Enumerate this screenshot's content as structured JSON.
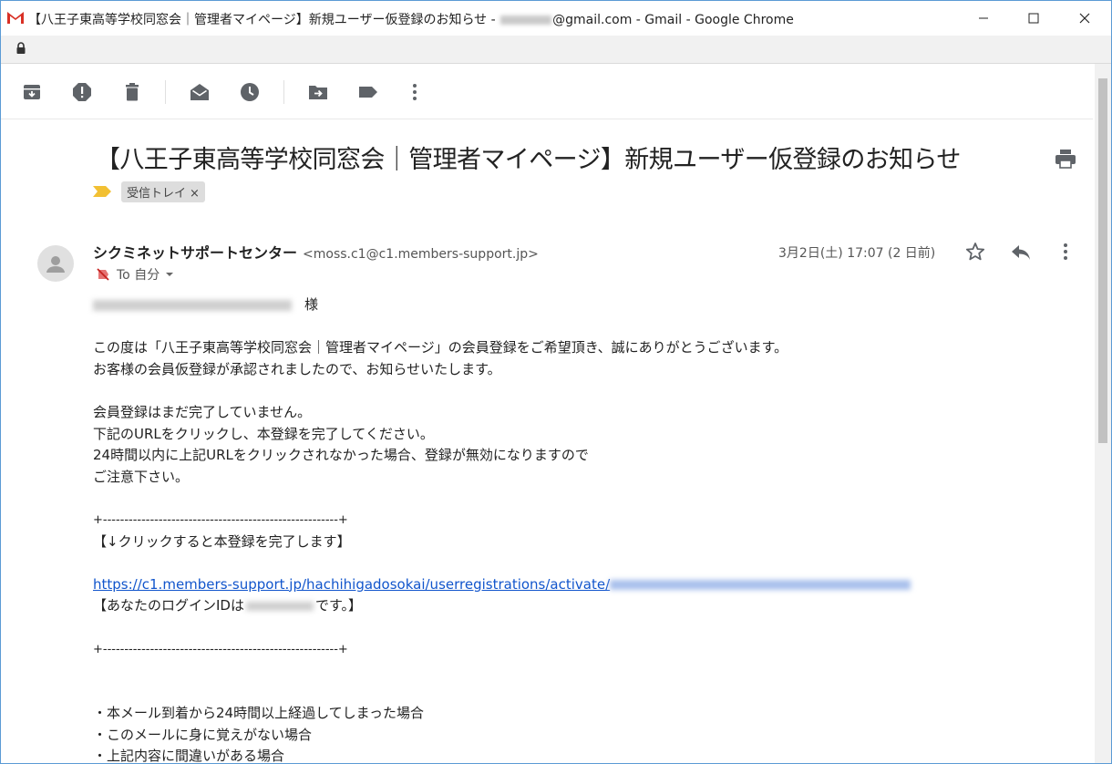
{
  "window": {
    "title_prefix": "【八王子東高等学校同窓会｜管理者マイページ】新規ユーザー仮登録のお知らせ - ",
    "title_suffix": "@gmail.com - Gmail - Google Chrome",
    "title_redacted": "takeno23"
  },
  "toolbar": {
    "icons": [
      "archive-icon",
      "report-spam-icon",
      "delete-icon",
      "mark-unread-icon",
      "snooze-icon",
      "move-to-icon",
      "labels-icon",
      "more-icon"
    ]
  },
  "message": {
    "subject": "【八王子東高等学校同窓会｜管理者マイページ】新規ユーザー仮登録のお知らせ",
    "label": "受信トレイ",
    "label_close": "×",
    "sender_name": "シクミネットサポートセンター",
    "sender_email": "<moss.c1@c1.members-support.jp>",
    "to": "To 自分",
    "date": "3月2日(土) 17:07 (2 日前)"
  },
  "body": {
    "salutation_redacted": "テスト テスト (テスト テスト)",
    "salutation": "様",
    "p1": "この度は「八王子東高等学校同窓会｜管理者マイページ」の会員登録をご希望頂き、誠にありがとうございます。",
    "p2": "お客様の会員仮登録が承認されましたので、お知らせいたします。",
    "p3": "会員登録はまだ完了していません。",
    "p4": "下記のURLをクリックし、本登録を完了してください。",
    "p5": "24時間以内に上記URLをクリックされなかった場合、登録が無効になりますので",
    "p6": "ご注意下さい。",
    "divider": "+-------------------------------------------------------+",
    "click_note": "【↓クリックすると本登録を完了します】",
    "link": "https://c1.members-support.jp/hachihigadosokai/userregistrations/activate/",
    "link_redacted": "14276ee034539e797ece7a7624%22c2f9f29c",
    "login_prefix": "【あなたのログインIDは",
    "login_redacted": "00400039",
    "login_suffix": "です。】",
    "bullet1": "・本メール到着から24時間以上経過してしまった場合",
    "bullet2": "・このメールに身に覚えがない場合",
    "bullet3": "・上記内容に間違いがある場合"
  },
  "colors": {
    "link": "#1155cc",
    "label_marker": "#f2c033",
    "gmail_red": "#d93025"
  }
}
